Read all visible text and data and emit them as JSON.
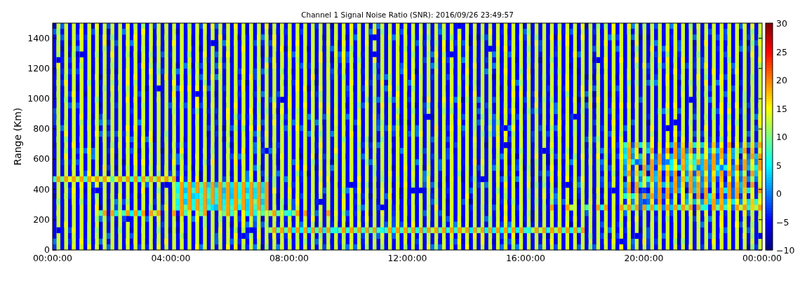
{
  "title": "Channel 1 Signal Noise Ratio (SNR): 2016/09/26 23:49:57",
  "ylabel": "Range (Km)",
  "x_ticks": [
    "00:00:00",
    "04:00:00",
    "08:00:00",
    "12:00:00",
    "16:00:00",
    "20:00:00",
    "00:00:00"
  ],
  "y_ticks": [
    "1400",
    "1200",
    "1000",
    "800",
    "600",
    "400",
    "200",
    "0"
  ],
  "colorbar_ticks": [
    "30",
    "25",
    "20",
    "15",
    "10",
    "5",
    "0",
    "−5",
    "−10"
  ]
}
